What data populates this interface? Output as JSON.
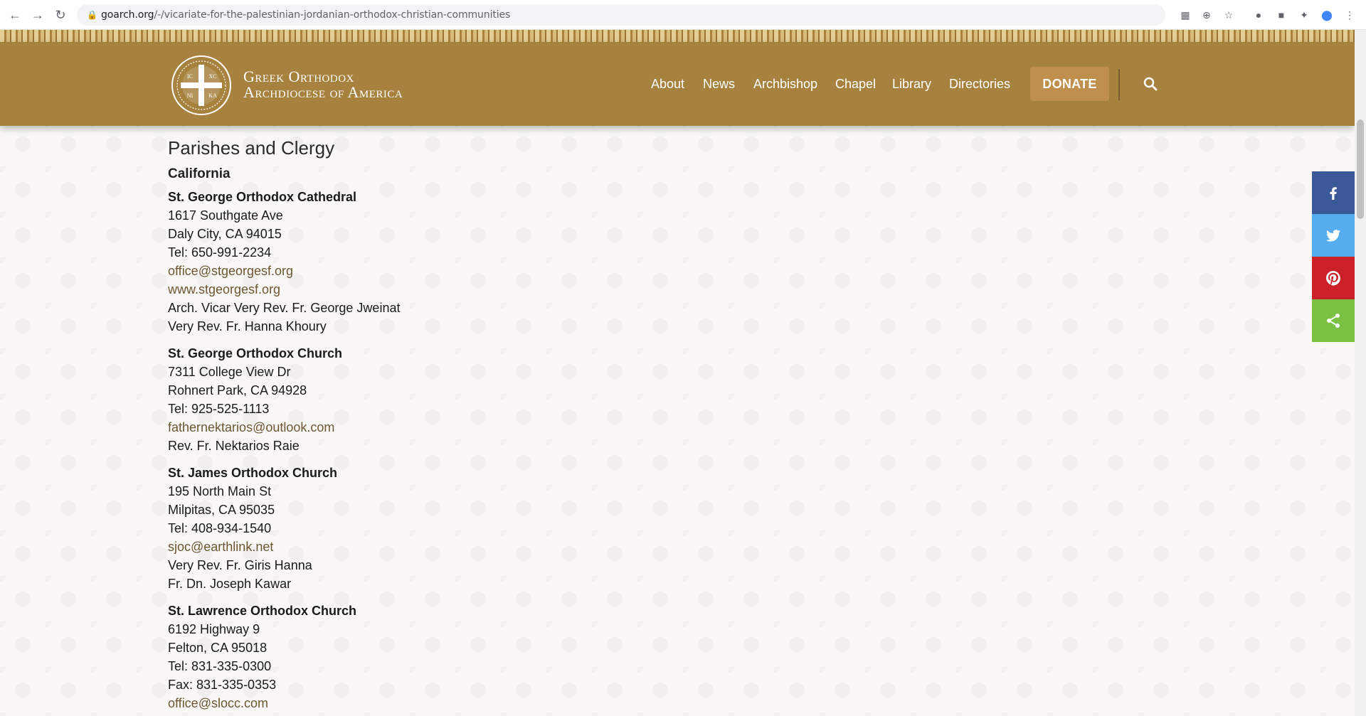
{
  "browser": {
    "url_host": "goarch.org",
    "url_path": "/-/vicariate-for-the-palestinian-jordanian-orthodox-christian-communities",
    "back_icon": "back-arrow-icon",
    "forward_icon": "forward-arrow-icon",
    "reload_icon": "reload-icon"
  },
  "header": {
    "brand_line1": "Greek Orthodox",
    "brand_line2": "Archdiocese of America",
    "logo_letters": [
      "IC",
      "XC",
      "NI",
      "KA"
    ],
    "nav": [
      "About",
      "News",
      "Archbishop",
      "Chapel",
      "Library",
      "Directories"
    ],
    "donate_label": "DONATE",
    "colors": {
      "header_bg": "#a7823f",
      "donate_bg": "#bf8f4d"
    }
  },
  "content": {
    "heading": "Parishes and Clergy",
    "state": "California",
    "parishes": [
      {
        "name": "St. George Orthodox Cathedral",
        "lines": [
          {
            "text": "1617 Southgate Ave",
            "type": "text"
          },
          {
            "text": "Daly City, CA 94015",
            "type": "text"
          },
          {
            "text": "Tel: 650-991-2234",
            "type": "text"
          },
          {
            "text": "office@stgeorgesf.org",
            "type": "link"
          },
          {
            "text": "www.stgeorgesf.org",
            "type": "link"
          },
          {
            "text": "Arch. Vicar Very Rev. Fr. George Jweinat",
            "type": "text"
          },
          {
            "text": "Very Rev. Fr. Hanna Khoury",
            "type": "text"
          }
        ]
      },
      {
        "name": "St. George Orthodox Church",
        "lines": [
          {
            "text": "7311 College View Dr",
            "type": "text"
          },
          {
            "text": "Rohnert Park, CA 94928",
            "type": "text"
          },
          {
            "text": "Tel: 925-525-1113",
            "type": "text"
          },
          {
            "text": "fathernektarios@outlook.com",
            "type": "link"
          },
          {
            "text": "Rev. Fr. Nektarios Raie",
            "type": "text"
          }
        ]
      },
      {
        "name": "St. James Orthodox Church",
        "lines": [
          {
            "text": "195 North Main St",
            "type": "text"
          },
          {
            "text": "Milpitas, CA 95035",
            "type": "text"
          },
          {
            "text": "Tel: 408-934-1540",
            "type": "text"
          },
          {
            "text": "sjoc@earthlink.net",
            "type": "link"
          },
          {
            "text": "Very Rev. Fr. Giris Hanna",
            "type": "text"
          },
          {
            "text": "Fr. Dn. Joseph Kawar",
            "type": "text"
          }
        ]
      },
      {
        "name": "St. Lawrence Orthodox Church",
        "lines": [
          {
            "text": "6192 Highway 9",
            "type": "text"
          },
          {
            "text": "Felton, CA 95018",
            "type": "text"
          },
          {
            "text": "Tel: 831-335-0300",
            "type": "text"
          },
          {
            "text": "Fax: 831-335-0353",
            "type": "text"
          },
          {
            "text": "office@slocc.com",
            "type": "link"
          }
        ]
      }
    ]
  },
  "share_bar": [
    {
      "name": "facebook",
      "icon": "facebook-icon",
      "color": "#3b5998"
    },
    {
      "name": "twitter",
      "icon": "twitter-icon",
      "color": "#55acee"
    },
    {
      "name": "pinterest",
      "icon": "pinterest-icon",
      "color": "#cb2027"
    },
    {
      "name": "share",
      "icon": "share-icon",
      "color": "#7ac143"
    }
  ]
}
